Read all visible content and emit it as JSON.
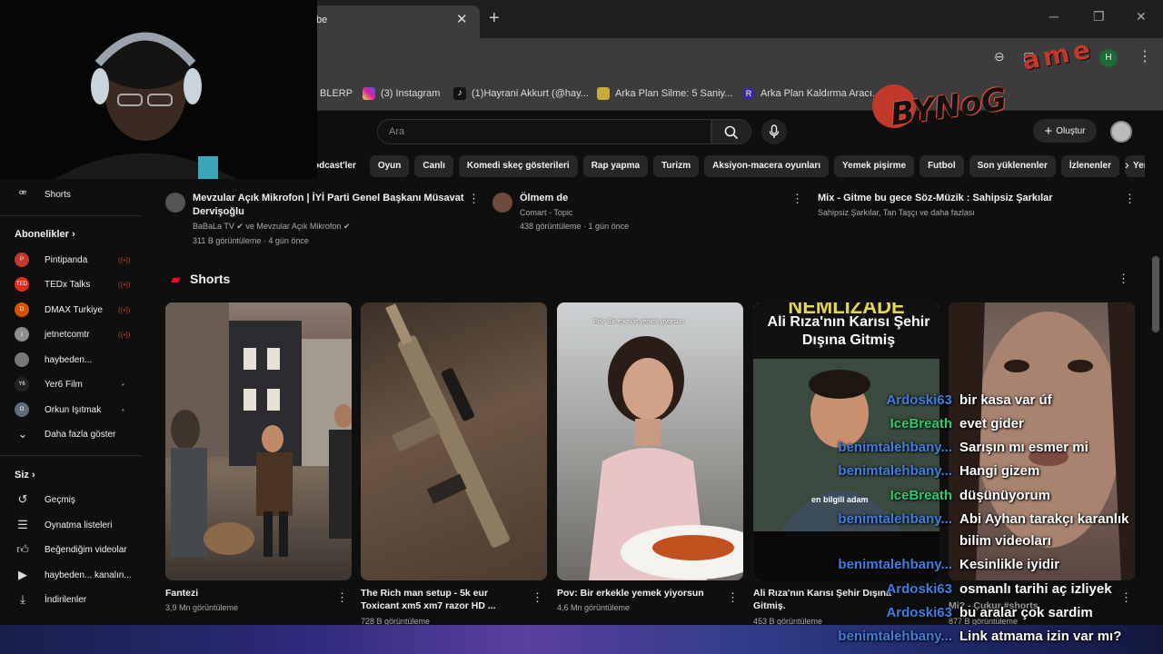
{
  "browser": {
    "tab_title": "be",
    "close": "✕",
    "new_tab": "+",
    "minimize": "─",
    "restore": "❐",
    "close_window": "✕",
    "profile_initial": "H",
    "menu": "⋮"
  },
  "bookmarks": [
    {
      "label": "BLERP",
      "color": "#3c3c3c"
    },
    {
      "label": "(3) Instagram",
      "color": "#d6249f"
    },
    {
      "label": "(1)Hayrani Akkurt (@hay...",
      "color": "#111111"
    },
    {
      "label": "Arka Plan Silme: 5 Saniy...",
      "color": "#c7a93e"
    },
    {
      "label": "Arka Plan Kaldırma Aracı...",
      "color": "#3d2a8c"
    }
  ],
  "logo": {
    "text1": "BYNoG",
    "text2": "ame"
  },
  "youtube": {
    "search_placeholder": "Ara",
    "create_label": "Oluştur",
    "chips": [
      "odcast'ler",
      "Oyun",
      "Canlı",
      "Komedi skeç gösterileri",
      "Rap yapma",
      "Turizm",
      "Aksiyon-macera oyunları",
      "Yemek pişirme",
      "Futbol",
      "Son yüklenenler",
      "İzlenenler",
      "Yeni öner"
    ]
  },
  "sidebar": {
    "shorts_label": "Shorts",
    "subs_header": "Abonelikler",
    "subs": [
      {
        "label": "Pintipanda",
        "badge": "live",
        "color": "#c0392b"
      },
      {
        "label": "TEDx Talks",
        "badge": "live",
        "color": "#e62b1e"
      },
      {
        "label": "DMAX Turkiye",
        "badge": "live",
        "color": "#d35400"
      },
      {
        "label": "jetnetcomtr",
        "badge": "live",
        "color": "#8e8e8e"
      },
      {
        "label": "haybeden...",
        "badge": "",
        "color": "#777777"
      },
      {
        "label": "Yer6 Film",
        "badge": "dot",
        "color": "#222222"
      },
      {
        "label": "Orkun Işıtmak",
        "badge": "dot",
        "color": "#5d6d7e"
      }
    ],
    "show_more": "Daha fazla göster",
    "you_header": "Siz",
    "you_items": [
      "Geçmiş",
      "Oynatma listeleri",
      "Beğendiğim videolar",
      "haybeden... kanalın...",
      "İndirilenler"
    ],
    "live_glyph": "((•))",
    "dot_glyph": "•"
  },
  "videos": [
    {
      "title": "Mevzular Açık Mikrofon | İYİ Parti Genel Başkanı Müsavat Dervişoğlu",
      "channel": "BaBaLa TV ✔ ve Mevzular Açık Mikrofon ✔",
      "meta": "311 B görüntüleme · 4 gün önce"
    },
    {
      "title": "Ölmem de",
      "channel": "Comart - Topic",
      "meta": "438 görüntüleme · 1 gün önce"
    },
    {
      "title": "Mix - Gitme bu gece   Söz-Müzik : Sahipsiz Şarkılar",
      "channel": "Sahipsiz Şarkılar, Tan Taşçı ve daha fazlası",
      "meta": ""
    }
  ],
  "shorts_header": "Shorts",
  "shorts": [
    {
      "title": "Fantezi",
      "views": "3,9 Mn görüntüleme",
      "caption": ""
    },
    {
      "title": "The Rich man setup  - 5k eur Toxicant xm5 xm7 razor HD ...",
      "views": "728 B görüntüleme",
      "caption": ""
    },
    {
      "title": "Pov: Bir erkekle yemek yiyorsun",
      "views": "4,6 Mn görüntüleme",
      "caption": "Pov: Bir erkekle yemek yiyorsun"
    },
    {
      "title": "Ali Rıza'nın Karısı Şehir Dışına Gitmiş.",
      "views": "453 B görüntüleme",
      "caption": "Ali Rıza'nın Karısı Şehir Dışına Gitmiş",
      "top_caption": "NEMLİZADE",
      "bottom_caption": "en bilgili adam"
    },
    {
      "title": "Mi? - Çukur #shorts",
      "views": "877 B görüntüleme",
      "caption": ""
    }
  ],
  "chat": [
    {
      "user": "Ardoski63",
      "msg": "bir kasa var úf",
      "color": "#3f7fe0"
    },
    {
      "user": "IceBreath",
      "msg": "evet gider",
      "color": "#2ecc71"
    },
    {
      "user": "benimtalehbany...",
      "msg": "Sarışın mı esmer mi",
      "color": "#3f7fe0"
    },
    {
      "user": "benimtalehbany...",
      "msg": "Hangi gizem",
      "color": "#3f7fe0"
    },
    {
      "user": "IceBreath",
      "msg": "düşünüyorum",
      "color": "#2ecc71"
    },
    {
      "user": "benimtalehbany...",
      "msg": "Abi Ayhan tarakçı karanlık",
      "color": "#3f7fe0"
    },
    {
      "user": "",
      "msg": "bilim videoları",
      "color": "#3f7fe0"
    },
    {
      "user": "benimtalehbany...",
      "msg": "Kesinlikle iyidir",
      "color": "#3f7fe0"
    },
    {
      "user": "Ardoski63",
      "msg": "osmanlı tarihi aç izliyek",
      "color": "#3f7fe0"
    },
    {
      "user": "Ardoski63",
      "msg": "bu aralar çok sardim",
      "color": "#3f7fe0"
    },
    {
      "user": "benimtalehbany...",
      "msg": "Link atmama izin var mı?",
      "color": "#3f7fe0"
    }
  ]
}
